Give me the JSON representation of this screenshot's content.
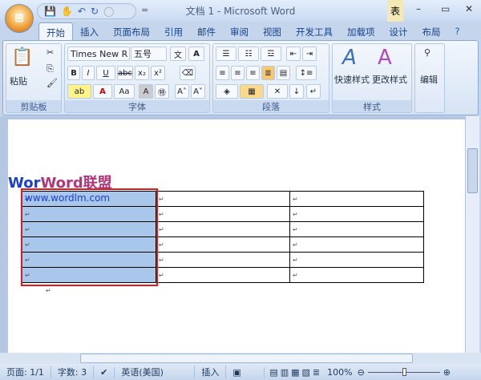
{
  "title": "文档 1 - Microsoft Word",
  "context_tab": "表",
  "window": {
    "minimize": "–",
    "maximize": "▭",
    "close": "✕"
  },
  "tabs": [
    "开始",
    "插入",
    "页面布局",
    "引用",
    "邮件",
    "审阅",
    "视图",
    "开发工具",
    "加载项",
    "设计",
    "布局"
  ],
  "clipboard": {
    "paste": "粘贴",
    "label": "剪贴板"
  },
  "font": {
    "name": "Times New R",
    "size": "五号",
    "bold": "B",
    "italic": "I",
    "underline": "U",
    "strike": "abc",
    "sub": "x₂",
    "sup": "x²",
    "color": "A",
    "case": "Aa",
    "grow": "A˄",
    "shrink": "A˅",
    "label": "字体"
  },
  "paragraph": {
    "label": "段落"
  },
  "styles": {
    "quick": "快速样式",
    "change": "更改样式",
    "label": "样式"
  },
  "editing": {
    "label": "编辑"
  },
  "watermark": {
    "brand": "Word联盟",
    "url": "www.wordlm.com"
  },
  "table": {
    "rows": 6,
    "cols": 3,
    "mark": "↵"
  },
  "status": {
    "page": "页面: 1/1",
    "words": "字数: 3",
    "lang": "英语(美国)",
    "mode": "插入",
    "zoom": "100%"
  }
}
